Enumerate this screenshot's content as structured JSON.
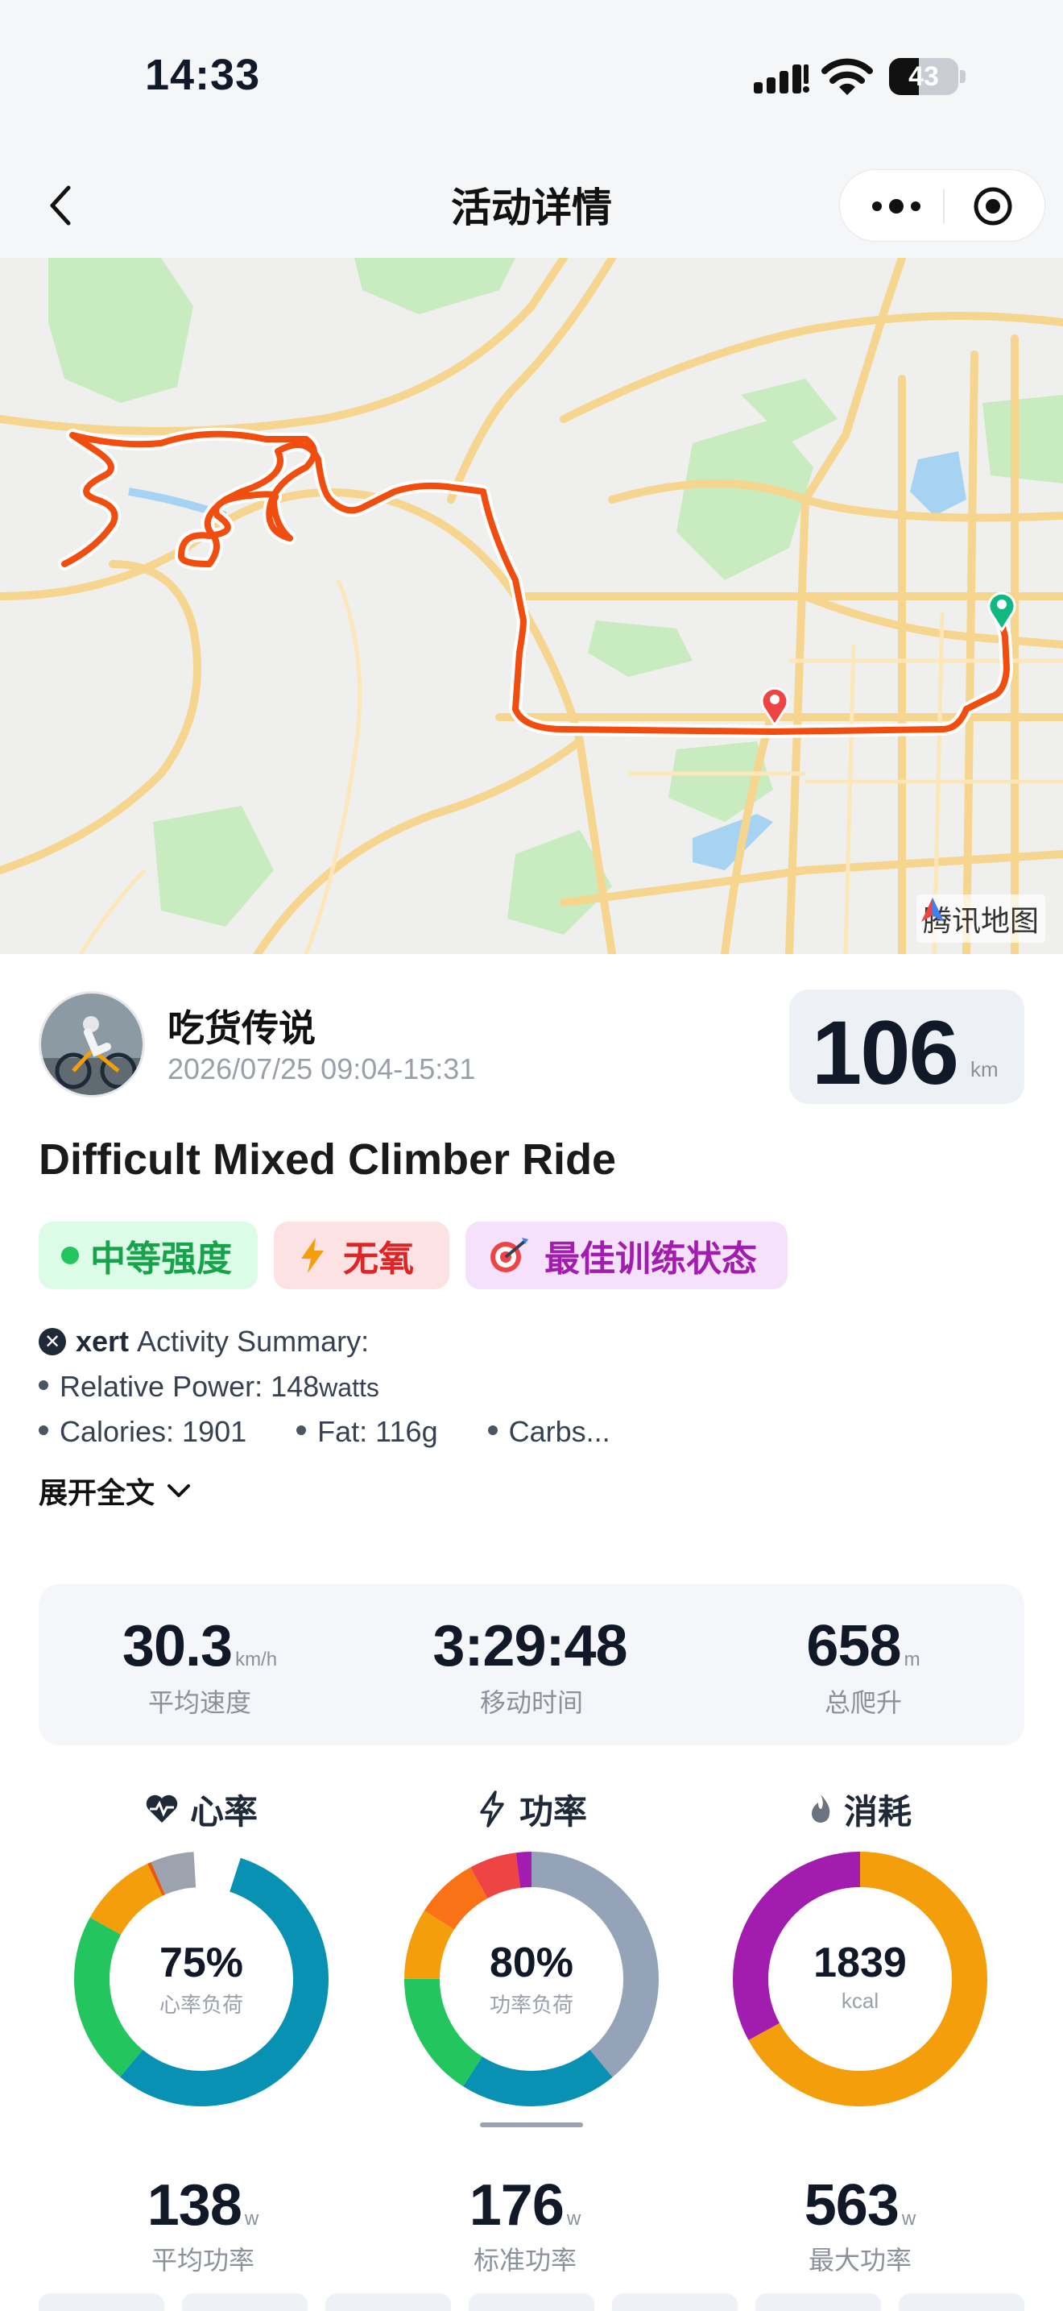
{
  "status_bar": {
    "time": "14:33",
    "battery": "43",
    "battery_level": 0.43
  },
  "nav": {
    "title": "活动详情"
  },
  "map": {
    "provider_label": "腾讯地图"
  },
  "profile": {
    "name": "吃货传说",
    "datetime": "2026/07/25 09:04-15:31"
  },
  "distance": {
    "value": "106",
    "unit": "km"
  },
  "activity": {
    "title": "Difficult Mixed Climber Ride"
  },
  "tags": [
    {
      "label": "中等强度",
      "color": "#16a34a",
      "icon": "green-dot"
    },
    {
      "label": "无氧",
      "color": "#dc2626",
      "icon": "lightning-icon"
    },
    {
      "label": "最佳训练状态",
      "color": "#a21caf",
      "icon": "target-icon"
    }
  ],
  "summary": {
    "brand": "xert",
    "heading": "Activity Summary:",
    "relative_power_label": "Relative Power: 148",
    "relative_power_unit": "watts",
    "calories": "Calories: 1901",
    "fat": "Fat: 116g",
    "carbs": "Carbs...",
    "expand_label": "展开全文"
  },
  "stats": [
    {
      "value": "30.3",
      "unit": "km/h",
      "label": "平均速度"
    },
    {
      "value": "3:29:48",
      "unit": "",
      "label": "移动时间"
    },
    {
      "value": "658",
      "unit": "m",
      "label": "总爬升"
    }
  ],
  "rings": [
    {
      "title": "心率",
      "icon": "heart-pulse-icon",
      "center_value": "75%",
      "center_label": "心率负荷",
      "segments": [
        {
          "color": "#0891b2",
          "fraction": 0.56
        },
        {
          "color": "#22c55e",
          "fraction": 0.22
        },
        {
          "color": "#f59e0b",
          "fraction": 0.1
        },
        {
          "color": "#ea580c",
          "fraction": 0.005
        },
        {
          "color": "#9ca3af",
          "fraction": 0.055
        }
      ],
      "start_fraction": 0.05
    },
    {
      "title": "功率",
      "icon": "lightning-outline-icon",
      "center_value": "80%",
      "center_label": "功率负荷",
      "segments": [
        {
          "color": "#94a3b8",
          "fraction": 0.39
        },
        {
          "color": "#0891b2",
          "fraction": 0.2
        },
        {
          "color": "#22c55e",
          "fraction": 0.16
        },
        {
          "color": "#f59e0b",
          "fraction": 0.09
        },
        {
          "color": "#f97316",
          "fraction": 0.08
        },
        {
          "color": "#ef4444",
          "fraction": 0.06
        },
        {
          "color": "#a21caf",
          "fraction": 0.02
        }
      ],
      "start_fraction": 0.0
    },
    {
      "title": "消耗",
      "icon": "flame-icon",
      "center_value": "1839",
      "center_label": "kcal",
      "segments": [
        {
          "color": "#f59e0b",
          "fraction": 0.67
        },
        {
          "color": "#a21caf",
          "fraction": 0.33
        }
      ],
      "start_fraction": 0.0
    }
  ],
  "power_stats": [
    {
      "value": "138",
      "unit": "w",
      "label": "平均功率"
    },
    {
      "value": "176",
      "unit": "w",
      "label": "标准功率"
    },
    {
      "value": "563",
      "unit": "w",
      "label": "最大功率"
    }
  ]
}
